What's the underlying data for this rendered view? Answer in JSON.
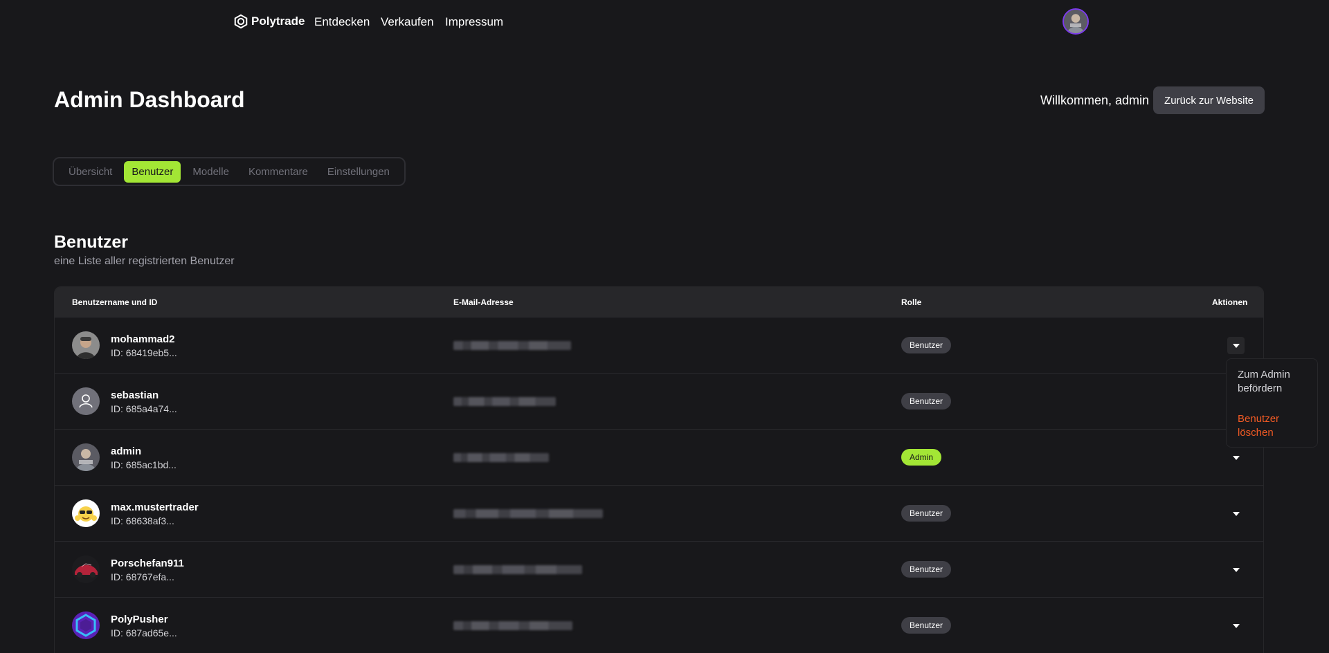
{
  "nav": {
    "brand": "Polytrade",
    "links": [
      "Entdecken",
      "Verkaufen",
      "Impressum"
    ]
  },
  "header": {
    "title": "Admin Dashboard",
    "welcome": "Willkommen, admin",
    "back_button": "Zurück zur Website"
  },
  "tabs": [
    "Übersicht",
    "Benutzer",
    "Modelle",
    "Kommentare",
    "Einstellungen"
  ],
  "active_tab": "Benutzer",
  "section": {
    "title": "Benutzer",
    "subtitle": "eine Liste aller registrierten Benutzer"
  },
  "table": {
    "columns": [
      "Benutzername und ID",
      "E-Mail-Adresse",
      "Rolle",
      "Aktionen"
    ],
    "rows": [
      {
        "username": "mohammad2",
        "id": "ID: 68419eb5...",
        "role": "Benutzer",
        "email": "redacted-email"
      },
      {
        "username": "sebastian",
        "id": "ID: 685a4a74...",
        "role": "Benutzer",
        "email": "redacted-email"
      },
      {
        "username": "admin",
        "id": "ID: 685ac1bd...",
        "role": "Admin",
        "email": "redacted-email"
      },
      {
        "username": "max.mustertrader",
        "id": "ID: 68638af3...",
        "role": "Benutzer",
        "email": "redacted-email"
      },
      {
        "username": "Porschefan911",
        "id": "ID: 68767efa...",
        "role": "Benutzer",
        "email": "redacted-email"
      },
      {
        "username": "PolyPusher",
        "id": "ID: 687ad65e...",
        "role": "Benutzer",
        "email": "redacted-email"
      }
    ]
  },
  "dropdown": {
    "promote": "Zum Admin befördern",
    "delete": "Benutzer löschen"
  },
  "colors": {
    "accent": "#a3e635",
    "danger": "#f05a24",
    "background": "#18181b"
  }
}
